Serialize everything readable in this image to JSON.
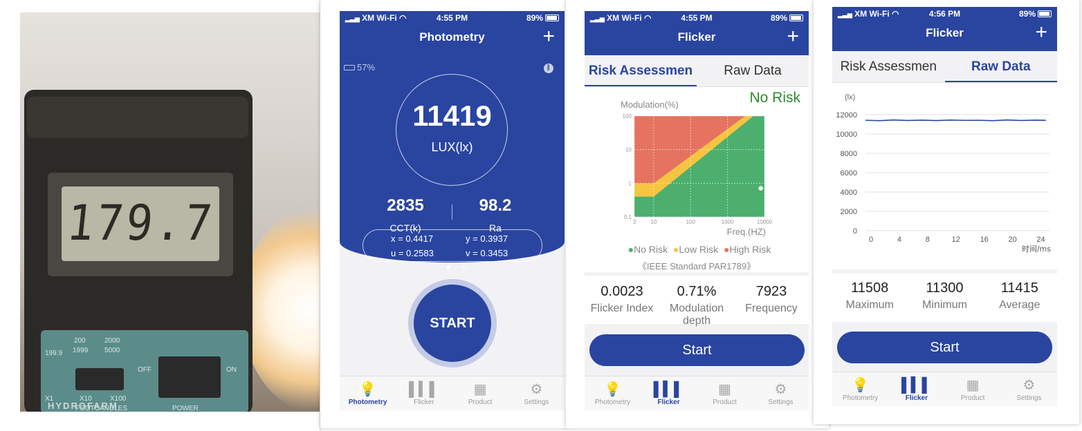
{
  "photo": {
    "lcd_reading": "179.7",
    "switch_labels": {
      "top": [
        "199.9",
        "200",
        "2000"
      ],
      "top2": [
        "1999",
        "5000"
      ],
      "off": "OFF",
      "on": "ON",
      "scales": [
        "X1",
        "X10",
        "X100"
      ],
      "footcandles": "FOOTCANDLES",
      "power": "POWER",
      "brand": "HYDROFARM"
    }
  },
  "status_bar": {
    "carrier": "XM Wi-Fi",
    "battery": "89%"
  },
  "photometry": {
    "time": "4:55 PM",
    "title": "Photometry",
    "plus": "+",
    "device_battery": "57%",
    "lux_value": "11419",
    "lux_unit": "LUX(lx)",
    "cct_value": "2835",
    "ra_value": "98.2",
    "cct_label": "CCT(k)",
    "ra_label": "Ra",
    "x": "x = 0.4417",
    "y": "y = 0.3937",
    "u": "u = 0.2583",
    "v": "v = 0.3453",
    "start": "START"
  },
  "flicker_risk": {
    "time": "4:55 PM",
    "title": "Flicker",
    "plus": "+",
    "tabs": [
      "Risk Assessmen",
      "Raw Data"
    ],
    "result": "No Risk",
    "chart_ylabel": "Modulation(%)",
    "chart_xlabel": "Freq.(HZ)",
    "y_ticks": [
      "100",
      "10",
      "1",
      "0.1"
    ],
    "x_ticks": [
      "3",
      "10",
      "100",
      "1000",
      "10000"
    ],
    "legend": [
      "No Risk",
      "Low Risk",
      "High Risk"
    ],
    "legend_colors": [
      "#4caf6e",
      "#f5c542",
      "#e57360"
    ],
    "standard": "《IEEE Standard PAR1789》",
    "stats": [
      {
        "value": "0.0023",
        "label": "Flicker Index"
      },
      {
        "value": "0.71%",
        "label": "Modulation depth"
      },
      {
        "value": "7923",
        "label": "Frequency"
      }
    ],
    "start": "Start"
  },
  "flicker_raw": {
    "time": "4:56 PM",
    "title": "Flicker",
    "plus": "+",
    "tabs": [
      "Risk Assessmen",
      "Raw Data"
    ],
    "stats": [
      {
        "value": "11508",
        "label": "Maximum"
      },
      {
        "value": "11300",
        "label": "Minimum"
      },
      {
        "value": "11415",
        "label": "Average"
      }
    ],
    "start": "Start"
  },
  "tabbar": [
    "Photometry",
    "Flicker",
    "Product",
    "Settings"
  ],
  "chart_data": [
    {
      "type": "area",
      "title": "",
      "ylabel": "Modulation(%)",
      "xlabel": "Freq.(HZ)",
      "x_scale": "log",
      "y_scale": "log",
      "xlim": [
        3,
        10000
      ],
      "ylim": [
        0.1,
        100
      ],
      "x_ticks": [
        3,
        10,
        100,
        1000,
        10000
      ],
      "y_ticks": [
        0.1,
        1,
        10,
        100
      ],
      "legend": [
        "No Risk",
        "Low Risk",
        "High Risk"
      ],
      "legend_position": "bottom",
      "series": [
        {
          "name": "Low Risk",
          "x": [
            3,
            10,
            3000
          ],
          "y": [
            1,
            1,
            100
          ]
        },
        {
          "name": "No Risk",
          "x": [
            3,
            10,
            5000
          ],
          "y": [
            0.4,
            0.4,
            100
          ]
        }
      ],
      "measured_point": {
        "x": 7923,
        "y": 0.71
      }
    },
    {
      "type": "line",
      "title": "",
      "ylabel": "(lx)",
      "xlabel": "时间/ms",
      "xlim": [
        0,
        26
      ],
      "ylim": [
        0,
        12000
      ],
      "x_ticks": [
        0,
        4,
        8,
        12,
        16,
        20,
        24
      ],
      "y_ticks": [
        0,
        2000,
        4000,
        6000,
        8000,
        10000,
        12000
      ],
      "grid": true,
      "series": [
        {
          "x": [
            0,
            2,
            4,
            6,
            8,
            10,
            12,
            14,
            16,
            18,
            20,
            22,
            24,
            25.5
          ],
          "y": [
            11420,
            11380,
            11450,
            11400,
            11430,
            11390,
            11440,
            11410,
            11420,
            11380,
            11450,
            11400,
            11430,
            11415
          ]
        }
      ]
    }
  ]
}
